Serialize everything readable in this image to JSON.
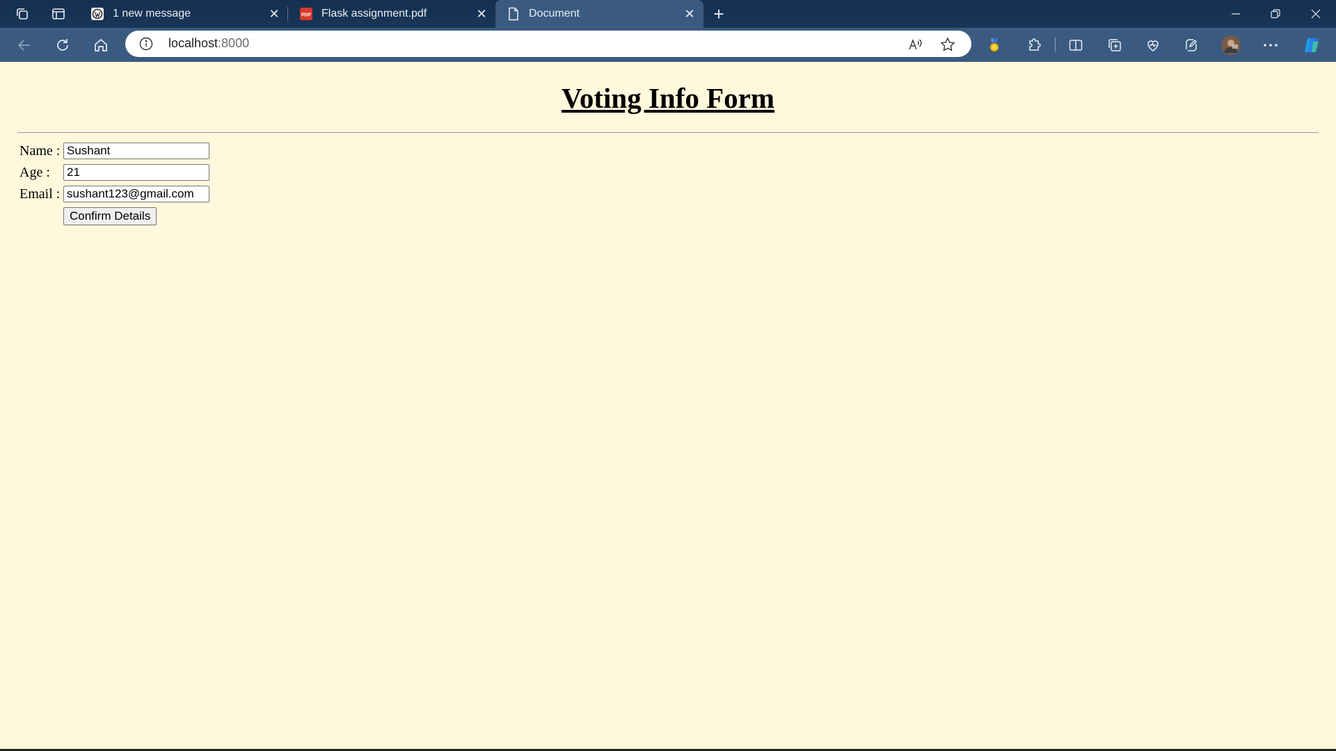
{
  "browser": {
    "tabs": [
      {
        "title": "1 new message",
        "icon": "wordpress-icon",
        "active": false
      },
      {
        "title": "Flask assignment.pdf",
        "icon": "pdf-icon",
        "active": false
      },
      {
        "title": "Document",
        "icon": "document-icon",
        "active": true
      }
    ],
    "address": {
      "host": "localhost",
      "port": ":8000"
    }
  },
  "page": {
    "title": "Voting Info Form",
    "form": {
      "name_label": "Name :",
      "name_value": "Sushant",
      "age_label": "Age :",
      "age_value": "21",
      "email_label": "Email :",
      "email_value": "sushant123@gmail.com",
      "submit_label": "Confirm Details"
    },
    "background_color": "#fff8dc"
  }
}
